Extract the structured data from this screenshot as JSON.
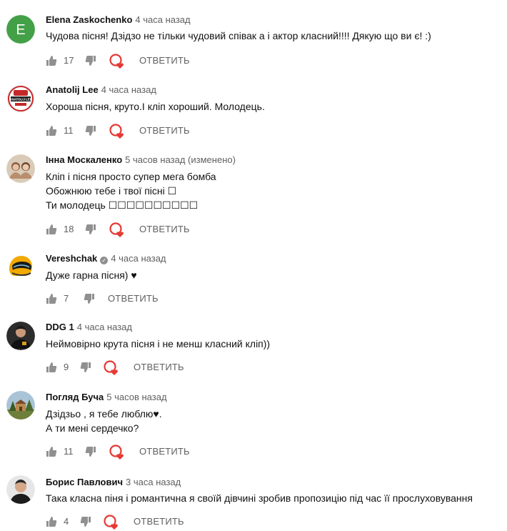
{
  "reply_label": "ОТВЕТИТЬ",
  "comments": [
    {
      "author": "Elena Zaskochenko",
      "time": "4 часа назад",
      "lines": [
        "Чудова пісня! Дзідзо не тільки чудовий співак а і актор класний!!!! Дякую що ви є! :)"
      ],
      "likes": "17",
      "avatar_letter": "E",
      "avatar_color": "#43a047"
    },
    {
      "author": "Anatolij Lee",
      "time": "4 часа назад",
      "lines": [
        "Хороша пісня, круто.І кліп хороший. Молодець."
      ],
      "likes": "11",
      "avatar_text": "ANATOLIJ LEE"
    },
    {
      "author": "Інна Москаленко",
      "time": "5 часов назад (изменено)",
      "lines": [
        "Кліп і пісня просто супер мега бомба",
        "Обожнюю тебе і твої пісні ☐",
        "Ти молодець ☐☐☐☐☐☐☐☐☐☐"
      ],
      "likes": "18"
    },
    {
      "author": "Vereshchak",
      "time": "4 часа назад",
      "lines": [
        "Дуже гарна пісня) ♥"
      ],
      "likes": "7",
      "verified": true
    },
    {
      "author": "DDG 1",
      "time": "4 часа назад",
      "lines": [
        "Неймовірно крута пісня і не менш класний кліп))"
      ],
      "likes": "9"
    },
    {
      "author": "Погляд Буча",
      "time": "5 часов назад",
      "lines": [
        "Дзідзьо , я тебе люблю♥.",
        "А ти мені сердечко?"
      ],
      "likes": "11"
    },
    {
      "author": "Борис Павлович",
      "time": "3 часа назад",
      "lines": [
        "Така класна піня і романтична я своїй дівчині зробив пропозицію під час її прослуховування"
      ],
      "likes": "4"
    }
  ],
  "colors": {
    "text": "#111111",
    "secondary": "#606060",
    "heart": "#e53935",
    "icon": "#909090"
  }
}
